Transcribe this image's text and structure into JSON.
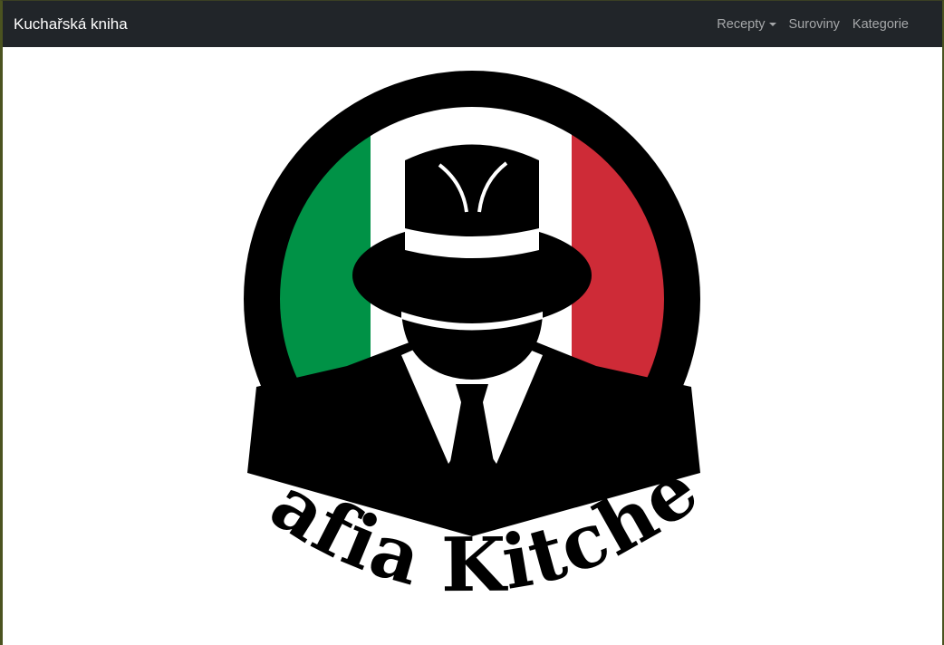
{
  "navbar": {
    "brand": "Kuchařská kniha",
    "items": [
      {
        "label": "Recepty",
        "dropdown": true
      },
      {
        "label": "Suroviny",
        "dropdown": false
      },
      {
        "label": "Kategorie",
        "dropdown": false
      }
    ]
  },
  "logo": {
    "text": "Mafia Kitchen",
    "colors": {
      "green": "#009246",
      "white": "#ffffff",
      "red": "#ce2b37",
      "black": "#000000"
    }
  },
  "theme": {
    "navbar_bg": "#212529",
    "link_color": "#a6a8aa"
  }
}
